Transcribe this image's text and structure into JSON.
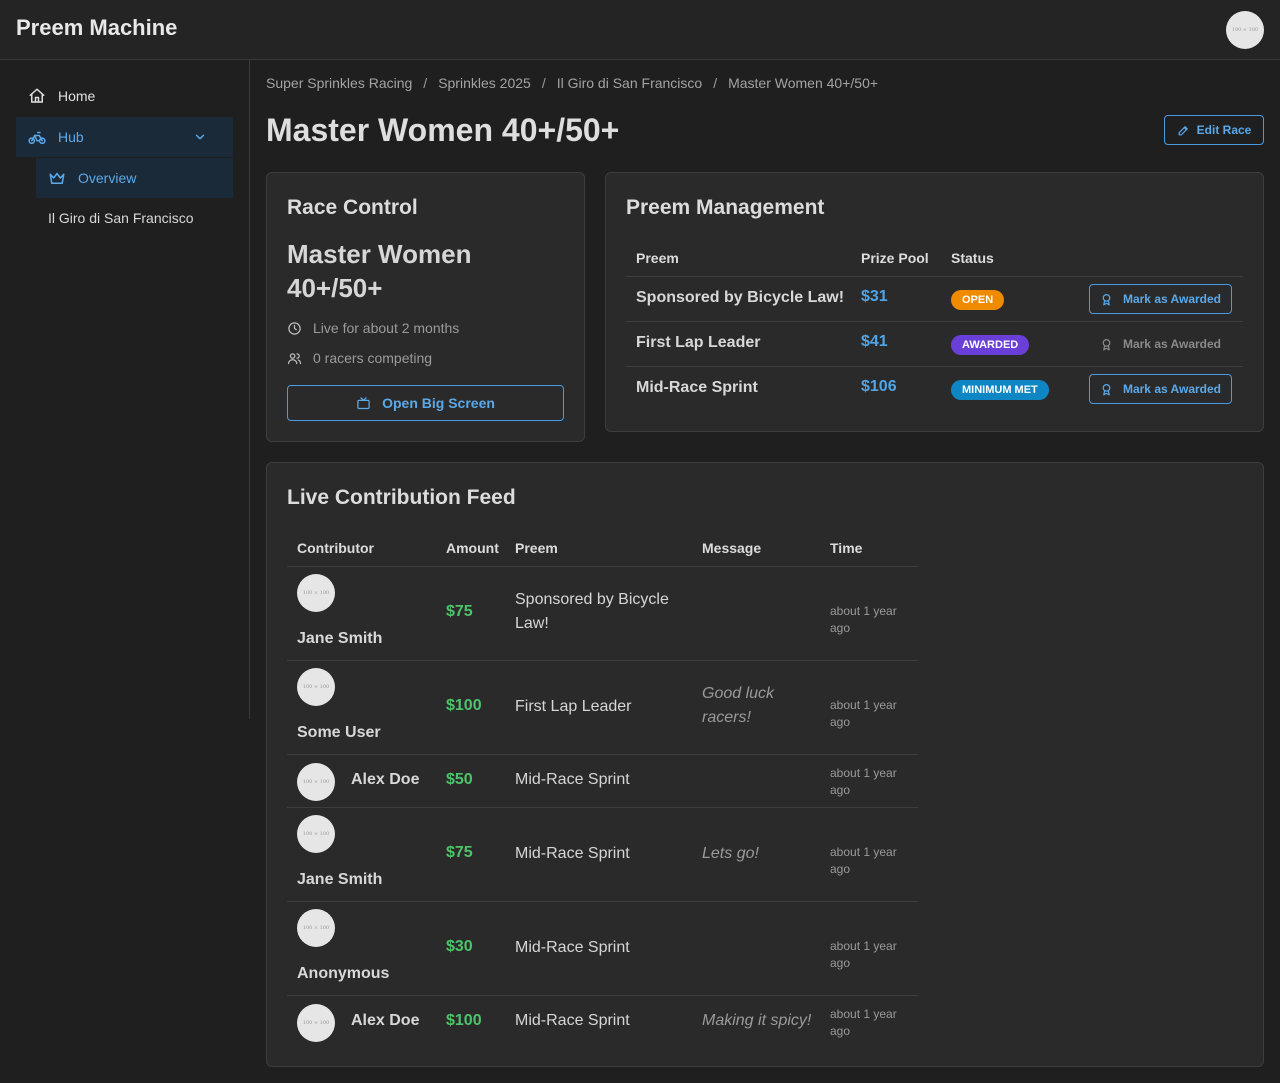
{
  "app": {
    "title": "Preem Machine",
    "avatar_text": "100 × 100"
  },
  "sidebar": {
    "home": "Home",
    "hub": "Hub",
    "overview": "Overview",
    "race_link": "Il Giro di San Francisco"
  },
  "breadcrumb": [
    "Super Sprinkles Racing",
    "Sprinkles 2025",
    "Il Giro di San Francisco",
    "Master Women 40+/50+"
  ],
  "page": {
    "title": "Master Women 40+/50+",
    "edit_label": "Edit Race"
  },
  "race_control": {
    "title": "Race Control",
    "race_name": "Master Women 40+/50+",
    "live": "Live for about 2 months",
    "racers": "0 racers competing",
    "big_screen_label": "Open Big Screen"
  },
  "preem_management": {
    "title": "Preem Management",
    "headers": {
      "preem": "Preem",
      "pool": "Prize Pool",
      "status": "Status"
    },
    "rows": [
      {
        "name": "Sponsored by Bicycle Law!",
        "pool": "$31",
        "status": "OPEN",
        "action": "Mark as Awarded"
      },
      {
        "name": "First Lap Leader",
        "pool": "$41",
        "status": "AWARDED",
        "action": "Mark as Awarded"
      },
      {
        "name": "Mid-Race Sprint",
        "pool": "$106",
        "status": "MINIMUM MET",
        "action": "Mark as Awarded"
      }
    ]
  },
  "feed": {
    "title": "Live Contribution Feed",
    "headers": {
      "contributor": "Contributor",
      "amount": "Amount",
      "preem": "Preem",
      "message": "Message",
      "time": "Time"
    },
    "rows": [
      {
        "name": "Jane Smith",
        "amount": "$75",
        "preem": "Sponsored by Bicycle Law!",
        "message": "",
        "time": "about 1 year ago"
      },
      {
        "name": "Some User",
        "amount": "$100",
        "preem": "First Lap Leader",
        "message": "Good luck racers!",
        "time": "about 1 year ago"
      },
      {
        "name": "Alex Doe",
        "amount": "$50",
        "preem": "Mid-Race Sprint",
        "message": "",
        "time": "about 1 year ago"
      },
      {
        "name": "Jane Smith",
        "amount": "$75",
        "preem": "Mid-Race Sprint",
        "message": "Lets go!",
        "time": "about 1 year ago"
      },
      {
        "name": "Anonymous",
        "amount": "$30",
        "preem": "Mid-Race Sprint",
        "message": "",
        "time": "about 1 year ago"
      },
      {
        "name": "Alex Doe",
        "amount": "$100",
        "preem": "Mid-Race Sprint",
        "message": "Making it spicy!",
        "time": "about 1 year ago"
      }
    ]
  },
  "colors": {
    "accent": "#5aa9ea",
    "amount_green": "#4cc46a",
    "open": "#f08a00",
    "awarded": "#6a3fd8",
    "minimum_met": "#0f86c4"
  }
}
